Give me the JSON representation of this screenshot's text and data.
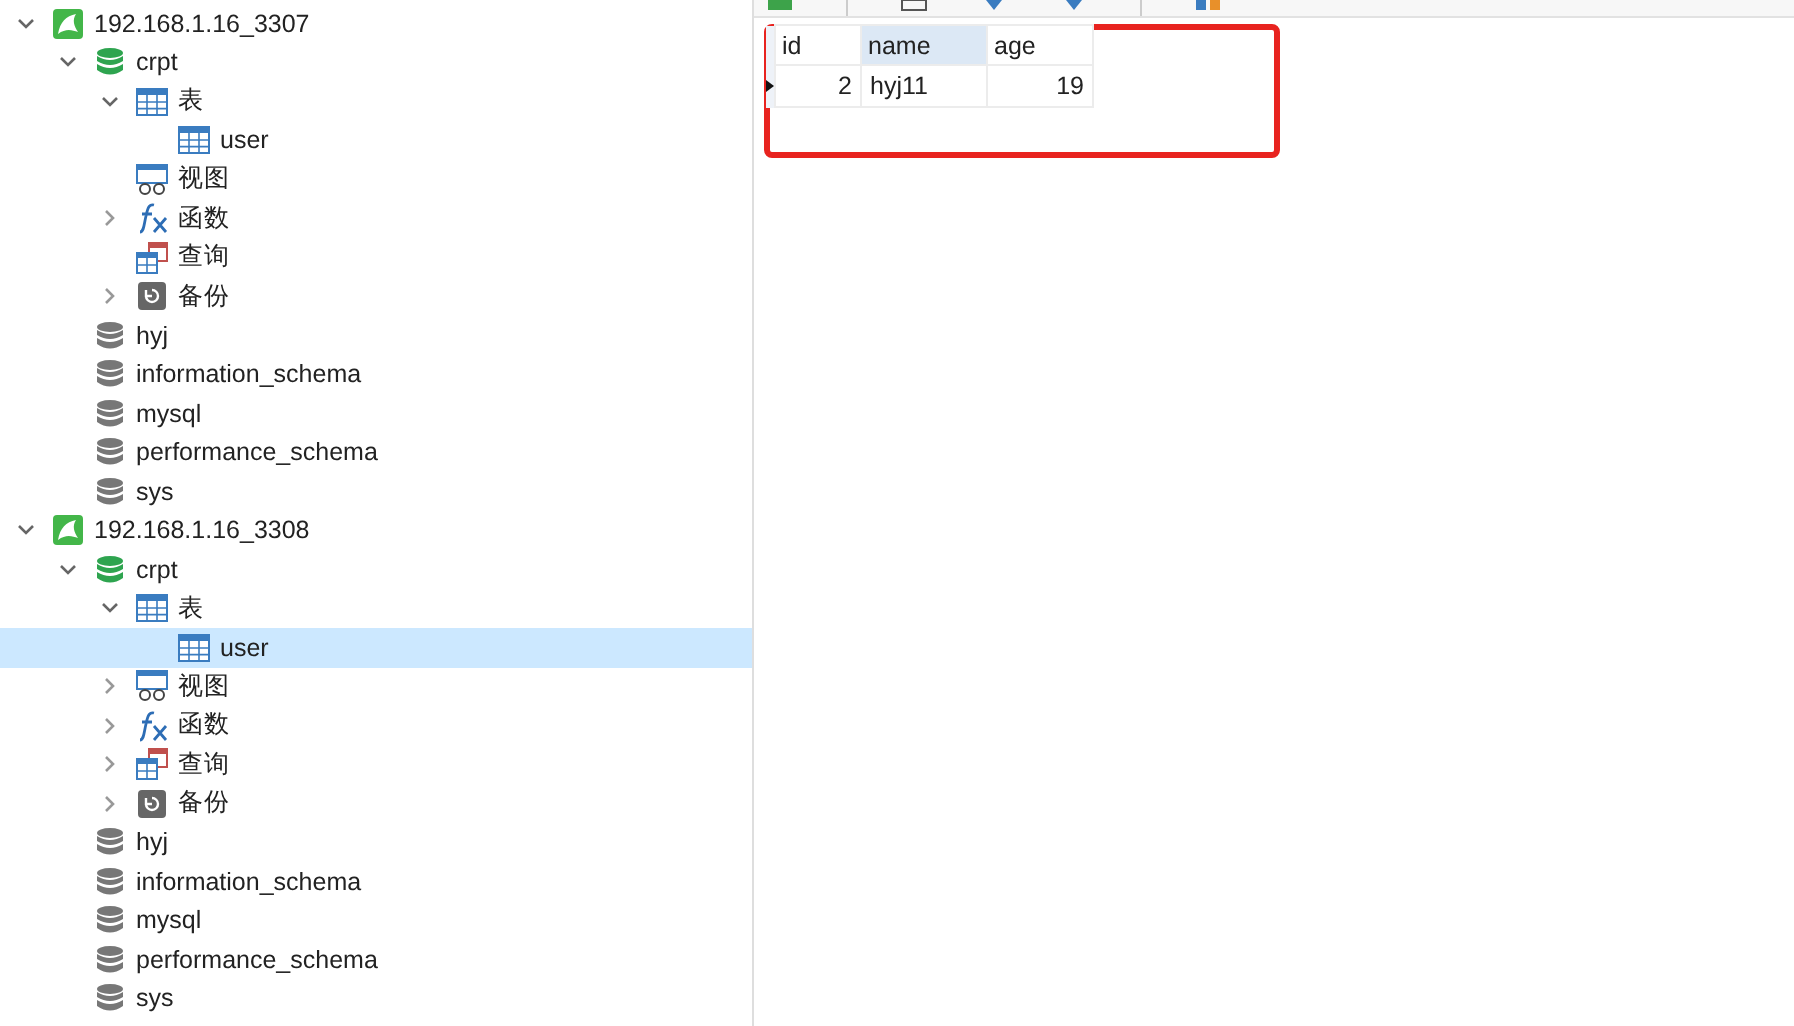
{
  "tree": [
    {
      "kind": "connection",
      "label": "192.168.1.16_3307",
      "expanded": true,
      "selected": false,
      "children": [
        {
          "kind": "database",
          "active": true,
          "label": "crpt",
          "expanded": true,
          "selected": false,
          "children": [
            {
              "kind": "tables",
              "label": "表",
              "expanded": true,
              "selected": false,
              "children": [
                {
                  "kind": "table",
                  "label": "user",
                  "selected": false
                }
              ]
            },
            {
              "kind": "views",
              "label": "视图",
              "selected": false
            },
            {
              "kind": "functions",
              "label": "函数",
              "expanded": false,
              "selected": false
            },
            {
              "kind": "queries",
              "label": "查询",
              "selected": false
            },
            {
              "kind": "backups",
              "label": "备份",
              "expanded": false,
              "selected": false
            }
          ]
        },
        {
          "kind": "database",
          "active": false,
          "label": "hyj",
          "selected": false
        },
        {
          "kind": "database",
          "active": false,
          "label": "information_schema",
          "selected": false
        },
        {
          "kind": "database",
          "active": false,
          "label": "mysql",
          "selected": false
        },
        {
          "kind": "database",
          "active": false,
          "label": "performance_schema",
          "selected": false
        },
        {
          "kind": "database",
          "active": false,
          "label": "sys",
          "selected": false
        }
      ]
    },
    {
      "kind": "connection",
      "label": "192.168.1.16_3308",
      "expanded": true,
      "selected": false,
      "children": [
        {
          "kind": "database",
          "active": true,
          "label": "crpt",
          "expanded": true,
          "selected": false,
          "children": [
            {
              "kind": "tables",
              "label": "表",
              "expanded": true,
              "selected": false,
              "children": [
                {
                  "kind": "table",
                  "label": "user",
                  "selected": true
                }
              ]
            },
            {
              "kind": "views",
              "label": "视图",
              "expanded": false,
              "selected": false
            },
            {
              "kind": "functions",
              "label": "函数",
              "expanded": false,
              "selected": false
            },
            {
              "kind": "queries",
              "label": "查询",
              "expanded": false,
              "selected": false
            },
            {
              "kind": "backups",
              "label": "备份",
              "expanded": false,
              "selected": false
            }
          ]
        },
        {
          "kind": "database",
          "active": false,
          "label": "hyj",
          "selected": false
        },
        {
          "kind": "database",
          "active": false,
          "label": "information_schema",
          "selected": false
        },
        {
          "kind": "database",
          "active": false,
          "label": "mysql",
          "selected": false
        },
        {
          "kind": "database",
          "active": false,
          "label": "performance_schema",
          "selected": false
        },
        {
          "kind": "database",
          "active": false,
          "label": "sys",
          "selected": false
        }
      ]
    }
  ],
  "grid": {
    "columns": [
      {
        "label": "id",
        "kind": "number",
        "selected": false
      },
      {
        "label": "name",
        "kind": "text",
        "selected": true
      },
      {
        "label": "age",
        "kind": "number",
        "selected": false
      }
    ],
    "rows": [
      {
        "cells": [
          "2",
          "hyj11",
          "19"
        ],
        "current": true
      }
    ]
  }
}
